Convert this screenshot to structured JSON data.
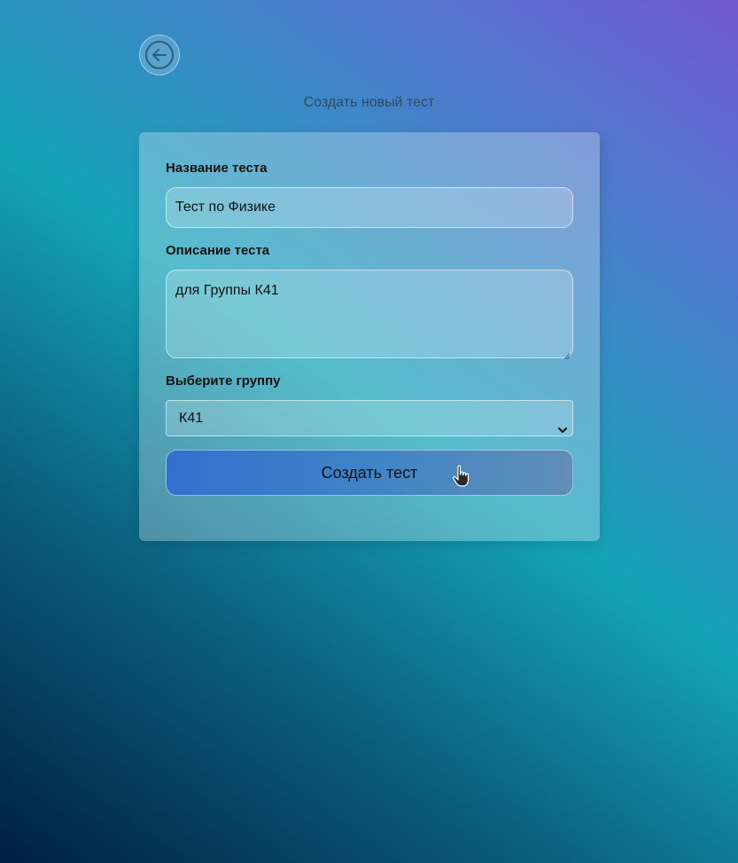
{
  "page": {
    "title": "Создать новый тест"
  },
  "back_button": {
    "icon": "arrow-left-circle-icon"
  },
  "form": {
    "name_label": "Название теста",
    "name_value": "Тест по Физике",
    "description_label": "Описание теста",
    "description_value": "для Группы К41",
    "group_label": "Выберите группу",
    "group_selected": "К41",
    "submit_label": "Создать тест"
  },
  "colors": {
    "accent_button": "#336fcf",
    "background_dark": "#001f40",
    "background_teal": "#14a3b8",
    "background_purple": "#7158cf"
  }
}
